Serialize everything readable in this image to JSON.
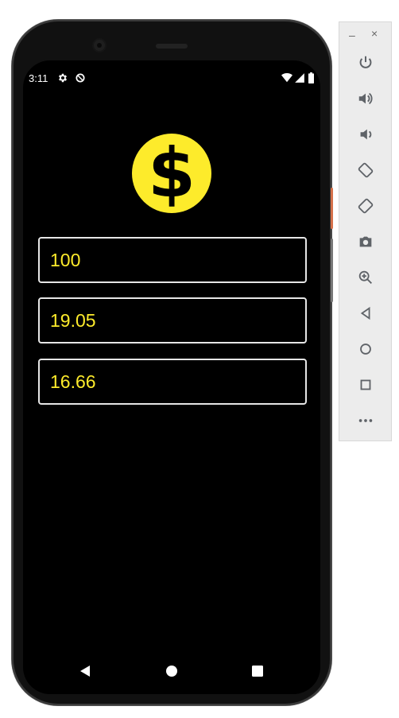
{
  "status_bar": {
    "time": "3:11",
    "left_icons": [
      "gear-icon",
      "data-saver-icon"
    ],
    "right_icons": [
      "wifi-icon",
      "signal-icon",
      "battery-icon"
    ]
  },
  "app": {
    "logo_icon": "dollar-coin-icon",
    "accent_color": "#fdeb2b",
    "fields": [
      {
        "value": "100"
      },
      {
        "value": "19.05"
      },
      {
        "value": "16.66"
      }
    ]
  },
  "nav_bar": {
    "buttons": [
      "back-icon",
      "home-icon",
      "recents-icon"
    ]
  },
  "emulator_toolbar": {
    "minimize_label": "–",
    "close_label": "×",
    "tools": [
      "power-icon",
      "volume-up-icon",
      "volume-down-icon",
      "rotate-left-icon",
      "rotate-right-icon",
      "camera-icon",
      "zoom-icon",
      "back-icon",
      "home-icon",
      "overview-icon",
      "more-icon"
    ]
  }
}
